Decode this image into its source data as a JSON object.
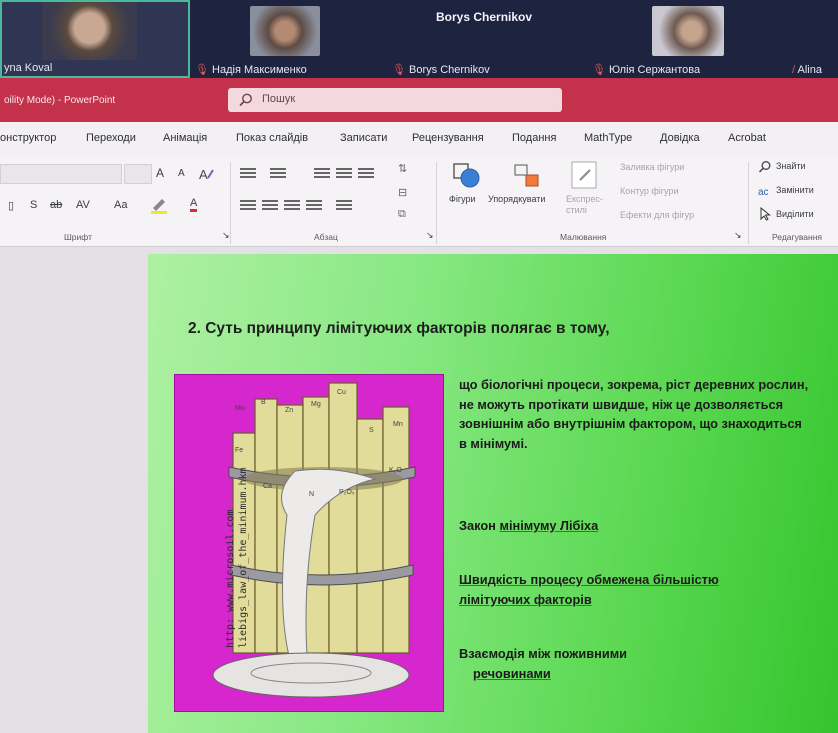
{
  "call": {
    "participants": [
      {
        "name": "yna Koval"
      },
      {
        "name": "Надія Максименко"
      },
      {
        "name": "Borys Chernikov"
      },
      {
        "name": "Юлія Сержантова"
      },
      {
        "name": "Alina"
      }
    ],
    "active_speaker": "Borys Chernikov"
  },
  "window": {
    "title": "oility Mode) - PowerPoint",
    "search_placeholder": "Пошук"
  },
  "tabs": [
    "онструктор",
    "Переходи",
    "Анімація",
    "Показ слайдів",
    "Записати",
    "Рецензування",
    "Подання",
    "MathType",
    "Довідка",
    "Acrobat"
  ],
  "ribbon": {
    "font": {
      "label": "Шрифт",
      "grow": "A",
      "shrink": "A",
      "underline": "S",
      "spacing": "AV",
      "case": "Aa",
      "color": "A"
    },
    "paragraph": {
      "label": "Абзац"
    },
    "drawing": {
      "label": "Малювання",
      "shapes": "Фігури",
      "arrange": "Упорядкувати",
      "quick_styles": "Експрес-стилі",
      "fill": "Заливка фігури",
      "outline": "Контур фігури",
      "effects": "Ефекти для фігур"
    },
    "editing": {
      "label": "Редагування",
      "find": "Знайти",
      "replace": "Замінити",
      "select": "Виділити"
    }
  },
  "slide": {
    "title": "2. Суть принципу лімітуючих факторів полягає в тому,",
    "body": "що біологічні процеси, зокрема, ріст деревних рослин, не можуть протікати швидше, ніж це дозволяється зовнішнім або внутрішнім фактором, що знаходиться в мінімумі.",
    "law_prefix": "Закон ",
    "law_link": "мінімуму Лібіха",
    "rate_text": "Швидкість процесу обмежена більшістю",
    "rate_link": "лімітуючих факторів",
    "interaction_line1": "Взаємодія між поживними",
    "interaction_line2": "речовинами",
    "picture": {
      "watermark_line1": "http: www.microsoil.com",
      "watermark_line2": "liebigs_law_of_the_minimum.hkm",
      "stave_labels": [
        "Mo",
        "B",
        "Zn",
        "Mg",
        "Cu",
        "S",
        "Mn",
        "Fe",
        "Ca",
        "N",
        "P₂O₅",
        "K₂O"
      ]
    }
  },
  "colors": {
    "titlebar": "#c4314b",
    "slide_gradient_start": "#aef0a2",
    "slide_gradient_end": "#34c42e",
    "picture_bg": "#d627cf"
  }
}
